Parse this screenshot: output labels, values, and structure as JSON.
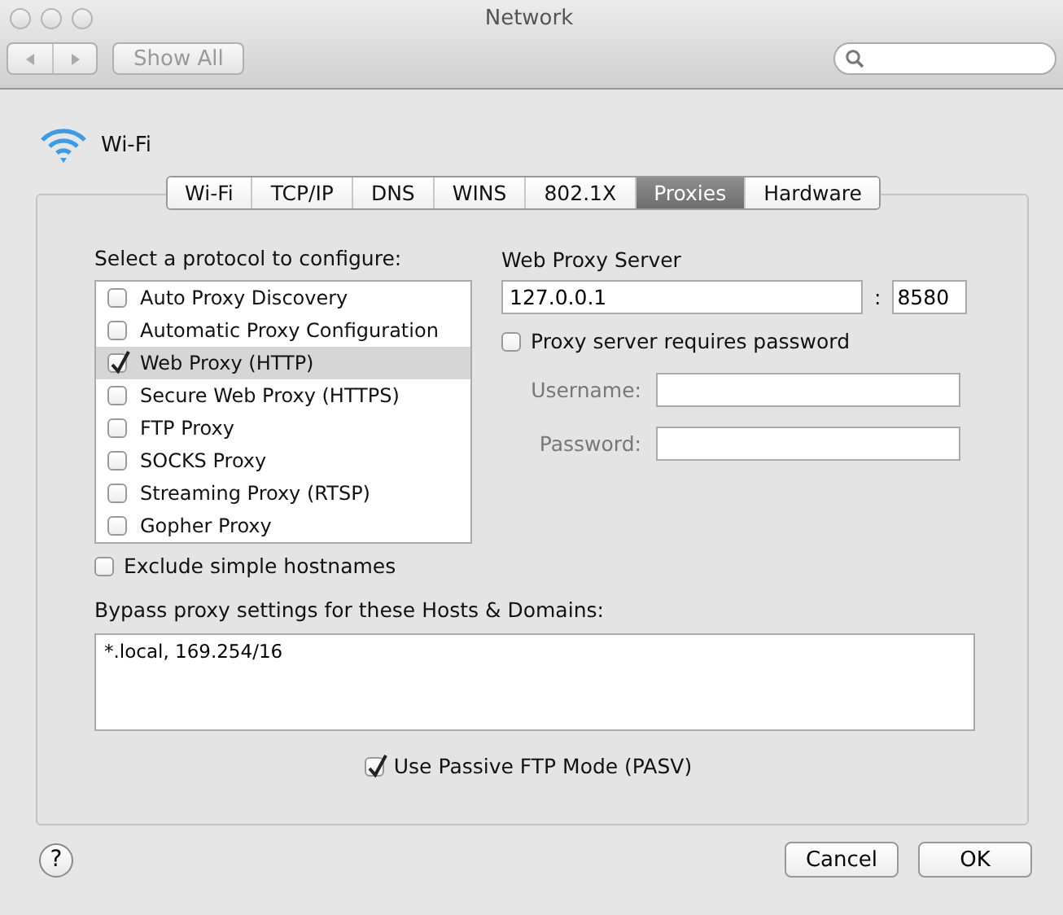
{
  "window": {
    "title": "Network"
  },
  "toolbar": {
    "show_all": "Show All"
  },
  "service": {
    "name": "Wi-Fi"
  },
  "tabs": [
    {
      "label": "Wi-Fi",
      "selected": false
    },
    {
      "label": "TCP/IP",
      "selected": false
    },
    {
      "label": "DNS",
      "selected": false
    },
    {
      "label": "WINS",
      "selected": false
    },
    {
      "label": "802.1X",
      "selected": false
    },
    {
      "label": "Proxies",
      "selected": true
    },
    {
      "label": "Hardware",
      "selected": false
    }
  ],
  "protocols": {
    "label": "Select a protocol to configure:",
    "items": [
      {
        "label": "Auto Proxy Discovery",
        "checked": false,
        "selected": false
      },
      {
        "label": "Automatic Proxy Configuration",
        "checked": false,
        "selected": false
      },
      {
        "label": "Web Proxy (HTTP)",
        "checked": true,
        "selected": true
      },
      {
        "label": "Secure Web Proxy (HTTPS)",
        "checked": false,
        "selected": false
      },
      {
        "label": "FTP Proxy",
        "checked": false,
        "selected": false
      },
      {
        "label": "SOCKS Proxy",
        "checked": false,
        "selected": false
      },
      {
        "label": "Streaming Proxy (RTSP)",
        "checked": false,
        "selected": false
      },
      {
        "label": "Gopher Proxy",
        "checked": false,
        "selected": false
      }
    ]
  },
  "exclude_simple_hostnames": {
    "label": "Exclude simple hostnames",
    "checked": false
  },
  "bypass": {
    "label": "Bypass proxy settings for these Hosts & Domains:",
    "value": "*.local, 169.254/16"
  },
  "web_proxy": {
    "title": "Web Proxy Server",
    "server": "127.0.0.1",
    "separator": ":",
    "port": "8580",
    "requires_password": {
      "label": "Proxy server requires password",
      "checked": false
    },
    "username": {
      "label": "Username:",
      "disabled": true
    },
    "password": {
      "label": "Password:",
      "disabled": true
    }
  },
  "passive_ftp": {
    "label": "Use Passive FTP Mode (PASV)",
    "checked": true
  },
  "help": "?",
  "buttons": [
    {
      "label": "Cancel"
    },
    {
      "label": "OK"
    }
  ]
}
